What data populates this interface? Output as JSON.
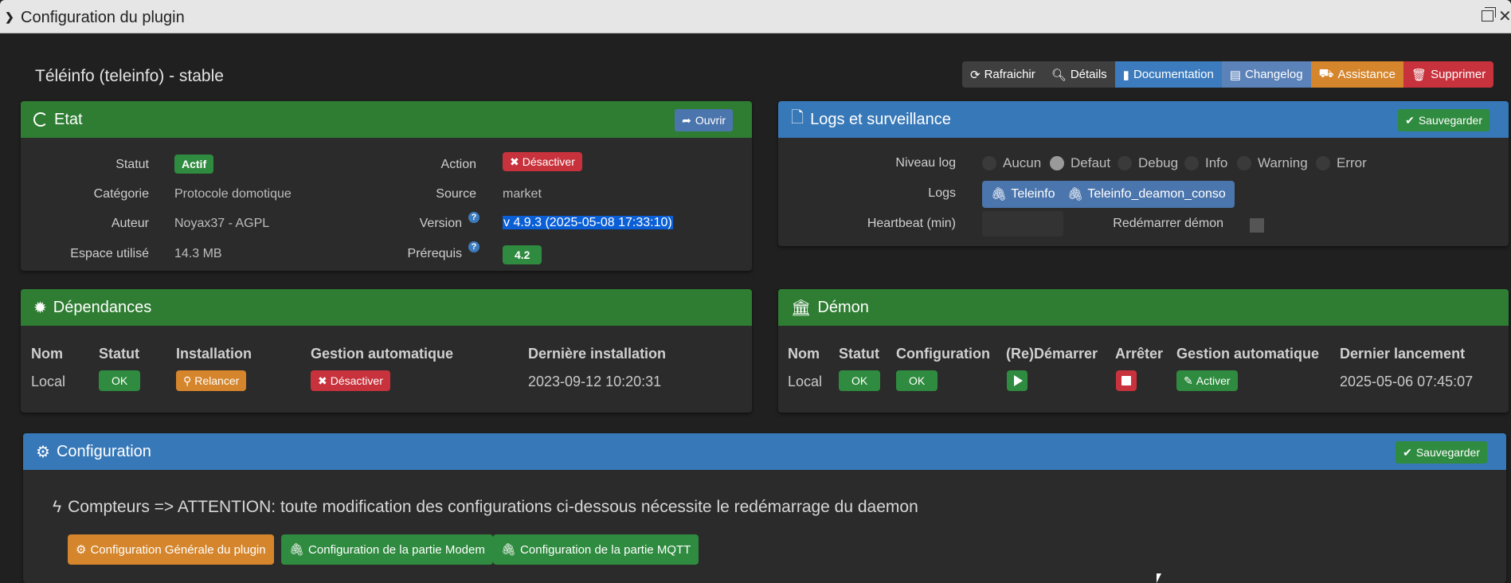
{
  "titlebar": {
    "title": "Configuration du plugin"
  },
  "plugin_title": "Téléinfo (teleinfo) - stable",
  "top_buttons": {
    "refresh": "Rafraichir",
    "details": "Détails",
    "documentation": "Documentation",
    "changelog": "Changelog",
    "assistance": "Assistance",
    "delete": "Supprimer"
  },
  "etat": {
    "title": "Etat",
    "open_button": "Ouvrir",
    "statut_label": "Statut",
    "statut_value": "Actif",
    "categorie_label": "Catégorie",
    "categorie_value": "Protocole domotique",
    "auteur_label": "Auteur",
    "auteur_value": "Noyax37 - AGPL",
    "espace_label": "Espace utilisé",
    "espace_value": "14.3 MB",
    "action_label": "Action",
    "action_value": "Désactiver",
    "source_label": "Source",
    "source_value": "market",
    "version_label": "Version",
    "version_value": "v 4.9.3 (2025-05-08 17:33:10)",
    "prerequis_label": "Prérequis",
    "prerequis_value": "4.2"
  },
  "logs": {
    "title": "Logs et surveillance",
    "save_button": "Sauvegarder",
    "niveau_label": "Niveau log",
    "levels": [
      "Aucun",
      "Defaut",
      "Debug",
      "Info",
      "Warning",
      "Error"
    ],
    "selected_level": "Defaut",
    "logs_label": "Logs",
    "log_files": [
      "Teleinfo",
      "Teleinfo_deamon_conso"
    ],
    "heartbeat_label": "Heartbeat (min)",
    "heartbeat_value": "",
    "restart_label": "Redémarrer démon"
  },
  "dependances": {
    "title": "Dépendances",
    "headers": [
      "Nom",
      "Statut",
      "Installation",
      "Gestion automatique",
      "Dernière installation"
    ],
    "row": {
      "nom": "Local",
      "statut": "OK",
      "installation": "Relancer",
      "gestion": "Désactiver",
      "derniere": "2023-09-12 10:20:31"
    }
  },
  "demon": {
    "title": "Démon",
    "headers": [
      "Nom",
      "Statut",
      "Configuration",
      "(Re)Démarrer",
      "Arrêter",
      "Gestion automatique",
      "Dernier lancement"
    ],
    "row": {
      "nom": "Local",
      "statut": "OK",
      "configuration": "OK",
      "gestion": "Activer",
      "dernier": "2025-05-06 07:45:07"
    }
  },
  "configuration": {
    "title": "Configuration",
    "save_button": "Sauvegarder",
    "notice": "Compteurs => ATTENTION: toute modification des configurations ci-dessous nécessite le redémarrage du daemon",
    "buttons": [
      "Configuration Générale du plugin",
      "Configuration de la partie Modem",
      "Configuration de la partie MQTT"
    ]
  }
}
